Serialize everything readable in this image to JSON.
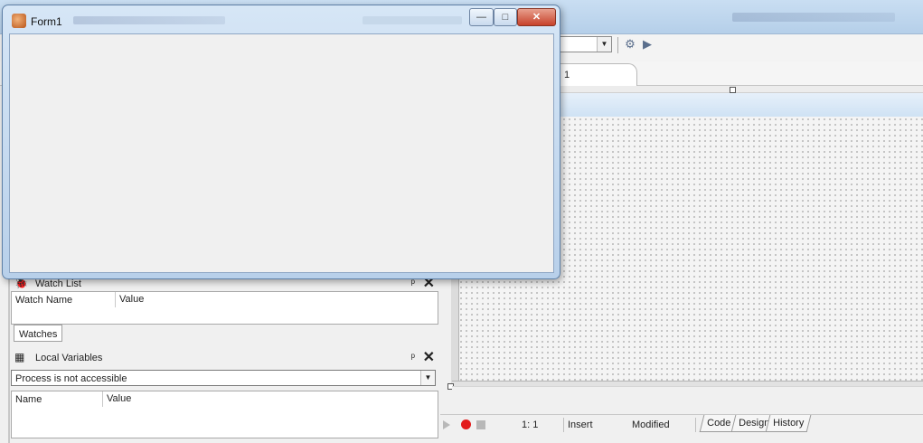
{
  "form_window": {
    "title": "Form1",
    "min_glyph": "—",
    "max_glyph": "□",
    "close_glyph": "✕"
  },
  "editor": {
    "tab_label": "1"
  },
  "watch_list": {
    "title": "Watch List",
    "columns": [
      "Watch Name",
      "Value"
    ],
    "tab_label": "Watches",
    "pin_glyph": "ᵖ",
    "close_glyph": "✕"
  },
  "local_variables": {
    "title": "Local Variables",
    "selected": "Process is not accessible",
    "columns": [
      "Name",
      "Value"
    ],
    "pin_glyph": "ᵖ",
    "close_glyph": "✕"
  },
  "status_bar": {
    "position": "1:  1",
    "mode": "Insert",
    "state": "Modified",
    "tabs": [
      "Code",
      "Design",
      "History"
    ]
  },
  "icons": {
    "form_icon": "app-icon",
    "watch_icon": "bug-icon",
    "locals_icon": "variables-icon"
  },
  "colors": {
    "record": "#e31b1b",
    "close_button": "#c7412a",
    "title_bar": "#c9def2"
  }
}
